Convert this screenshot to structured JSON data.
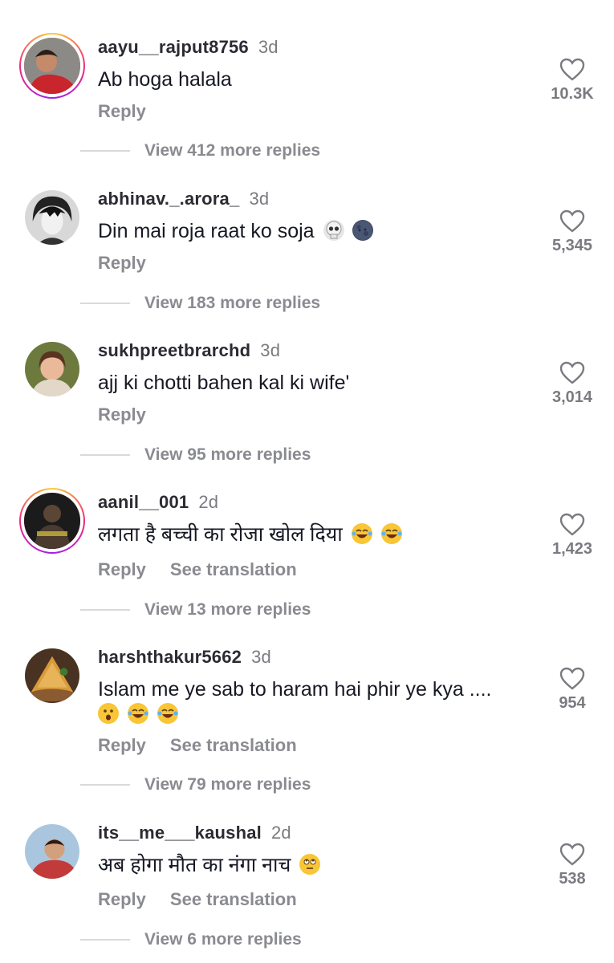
{
  "comments": [
    {
      "username": "aayu__rajput8756",
      "time": "3d",
      "text": "Ab hoga halala",
      "emojis": [],
      "reply_label": "Reply",
      "translate_label": "",
      "likes": "10.3K",
      "view_replies": "View 412 more replies",
      "avatar_icon": "avatar-photo-man-red-shirt"
    },
    {
      "username": "abhinav._.arora_",
      "time": "3d",
      "text": "Din mai roja raat ko soja",
      "emojis": [
        "skull-emoji",
        "new-moon-face-emoji"
      ],
      "reply_label": "Reply",
      "translate_label": "",
      "likes": "5,345",
      "view_replies": "View 183 more replies",
      "avatar_icon": "avatar-anime-boy"
    },
    {
      "username": "sukhpreetbrarchd",
      "time": "3d",
      "text": "ajj ki chotti bahen kal ki wife'",
      "emojis": [],
      "reply_label": "Reply",
      "translate_label": "",
      "likes": "3,014",
      "view_replies": "View 95 more replies",
      "avatar_icon": "avatar-photo-girl"
    },
    {
      "username": "aanil__001",
      "time": "2d",
      "text": "लगता है बच्ची का रोजा खोल दिया",
      "emojis": [
        "tears-of-joy-emoji",
        "tears-of-joy-emoji"
      ],
      "reply_label": "Reply",
      "translate_label": "See translation",
      "likes": "1,423",
      "view_replies": "View 13 more replies",
      "avatar_icon": "avatar-photo-dark"
    },
    {
      "username": "harshthakur5662",
      "time": "3d",
      "text": "Islam me ye sab to haram hai phir ye kya ....",
      "emojis": [
        "surprised-face-emoji",
        "tears-of-joy-emoji",
        "tears-of-joy-emoji"
      ],
      "reply_label": "Reply",
      "translate_label": "See translation",
      "likes": "954",
      "view_replies": "View 79 more replies",
      "avatar_icon": "avatar-photo-samosa"
    },
    {
      "username": "its__me___kaushal",
      "time": "2d",
      "text": "अब होगा मौत का नंगा नाच",
      "emojis": [
        "eye-roll-emoji"
      ],
      "reply_label": "Reply",
      "translate_label": "See translation",
      "likes": "538",
      "view_replies": "View 6 more replies",
      "avatar_icon": "avatar-photo-man-blue"
    }
  ]
}
